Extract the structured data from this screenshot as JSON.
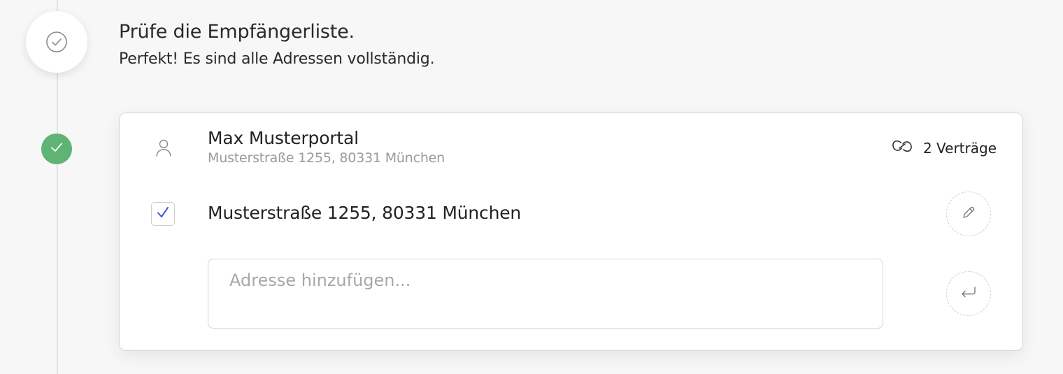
{
  "step": {
    "icon": "check-circle-icon",
    "title": "Prüfe die Empfängerliste.",
    "subtitle": "Perfekt! Es sind alle Adressen vollständig."
  },
  "recipient": {
    "status_icon": "check-icon",
    "status_color": "#5fb374",
    "person_icon": "person-icon",
    "name": "Max Musterportal",
    "address": "Musterstraße 1255, 80331 München",
    "contracts_icon": "link-icon",
    "contracts_label": "2 Verträge",
    "addresses": [
      {
        "text": "Musterstraße 1255, 80331 München",
        "checked": true
      }
    ],
    "new_address": {
      "value": "",
      "placeholder": "Adresse hinzufügen..."
    }
  },
  "colors": {
    "accent": "#3b5bdb",
    "success": "#5fb374"
  }
}
